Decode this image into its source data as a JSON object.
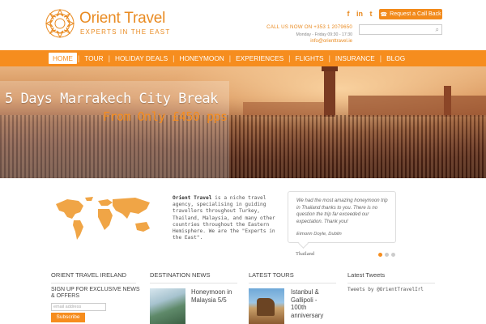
{
  "brand": {
    "name": "Orient Travel",
    "tagline": "EXPERTS IN THE EAST",
    "accent": "#f68d1e"
  },
  "header": {
    "social_icons": [
      "facebook-icon",
      "linkedin-icon",
      "twitter-icon"
    ],
    "callback_label": "Request a Call Back",
    "call_line": "CALL US NOW ON +353 1 2079650",
    "hours": "Monday - Friday 09:30 - 17:30",
    "email": "info@orienttravel.ie",
    "search_placeholder": ""
  },
  "nav": {
    "items": [
      "HOME",
      "TOUR",
      "HOLIDAY DEALS",
      "HONEYMOON",
      "EXPERIENCES",
      "FLIGHTS",
      "INSURANCE",
      "BLOG"
    ],
    "active": "HOME"
  },
  "hero": {
    "title": "5 Days Marrakech City Break",
    "subtitle": "From Only £450 pps"
  },
  "about": {
    "bold": "Orient Travel",
    "text": " is a niche travel agency, specialising in guiding travellers throughout Turkey, Thailand, Malaysia, and many other countries throughout the Eastern Hemisphere. We are the \"Experts in the East\"."
  },
  "testimonial": {
    "quote": "We had the most amazing honeymoon trip in Thailand thanks to you. There is no question the trip far exceeded our expectation. Thank you!",
    "author": "Eimonn Doyle, Dublin",
    "country": "Thailand",
    "slides": 3,
    "active_slide": 1
  },
  "footer": {
    "col1_title": "ORIENT TRAVEL IRELAND",
    "signup": "SIGN UP FOR EXCLUSIVE NEWS & OFFERS",
    "email_placeholder": "email address",
    "subscribe_label": "Subscribe",
    "col2_title": "DESTINATION NEWS",
    "news_item": "Honeymoon in Malaysia 5/5",
    "col3_title": "LATEST TOURS",
    "tour_item": "Istanbul & Gallipoli - 100th anniversary",
    "col4_title": "Latest Tweets",
    "tweets_text": "Tweets by @OrientTravelIrl"
  }
}
